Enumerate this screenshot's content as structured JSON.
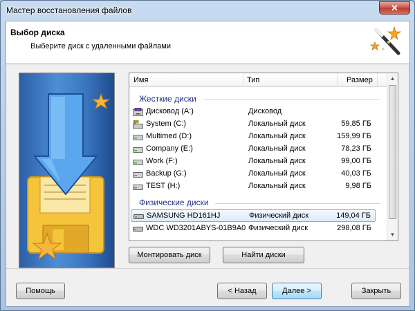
{
  "window": {
    "title": "Мастер восстановления файлов",
    "close_label": "✕"
  },
  "header": {
    "title": "Выбор диска",
    "subtitle": "Выберите диск с удаленными файлами"
  },
  "list": {
    "columns": {
      "name": "Имя",
      "type": "Тип",
      "size": "Размер"
    },
    "groups": [
      {
        "label": "Жесткие диски",
        "rows": [
          {
            "name": "Дисковод (A:)",
            "type": "Дисковод",
            "size": "",
            "icon": "floppy-drive-icon"
          },
          {
            "name": "System (C:)",
            "type": "Локальный диск",
            "size": "59,85 ГБ",
            "icon": "system-drive-icon"
          },
          {
            "name": "Multimed (D:)",
            "type": "Локальный диск",
            "size": "159,99 ГБ",
            "icon": "hard-drive-icon"
          },
          {
            "name": "Company (E:)",
            "type": "Локальный диск",
            "size": "78,23 ГБ",
            "icon": "hard-drive-icon"
          },
          {
            "name": "Work (F:)",
            "type": "Локальный диск",
            "size": "99,00 ГБ",
            "icon": "hard-drive-icon"
          },
          {
            "name": "Backup (G:)",
            "type": "Локальный диск",
            "size": "40,03 ГБ",
            "icon": "hard-drive-icon"
          },
          {
            "name": "TEST (H:)",
            "type": "Локальный диск",
            "size": "9,98 ГБ",
            "icon": "hard-drive-icon"
          }
        ]
      },
      {
        "label": "Физические диски",
        "rows": [
          {
            "name": "SAMSUNG HD161HJ",
            "type": "Физический диск",
            "size": "149,04 ГБ",
            "icon": "physical-disk-icon",
            "selected": true
          },
          {
            "name": "WDC WD3201ABYS-01B9A0",
            "type": "Физический диск",
            "size": "298,08 ГБ",
            "icon": "physical-disk-icon"
          }
        ]
      }
    ]
  },
  "buttons": {
    "mount": "Монтировать диск",
    "find": "Найти диски",
    "help": "Помощь",
    "back": "< Назад",
    "next": "Далее >",
    "close": "Закрыть"
  },
  "colors": {
    "group_text": "#1e3287",
    "selection_border": "#84acdd",
    "banner_blue": "#3a76c0",
    "floppy_yellow": "#f5c43a"
  }
}
